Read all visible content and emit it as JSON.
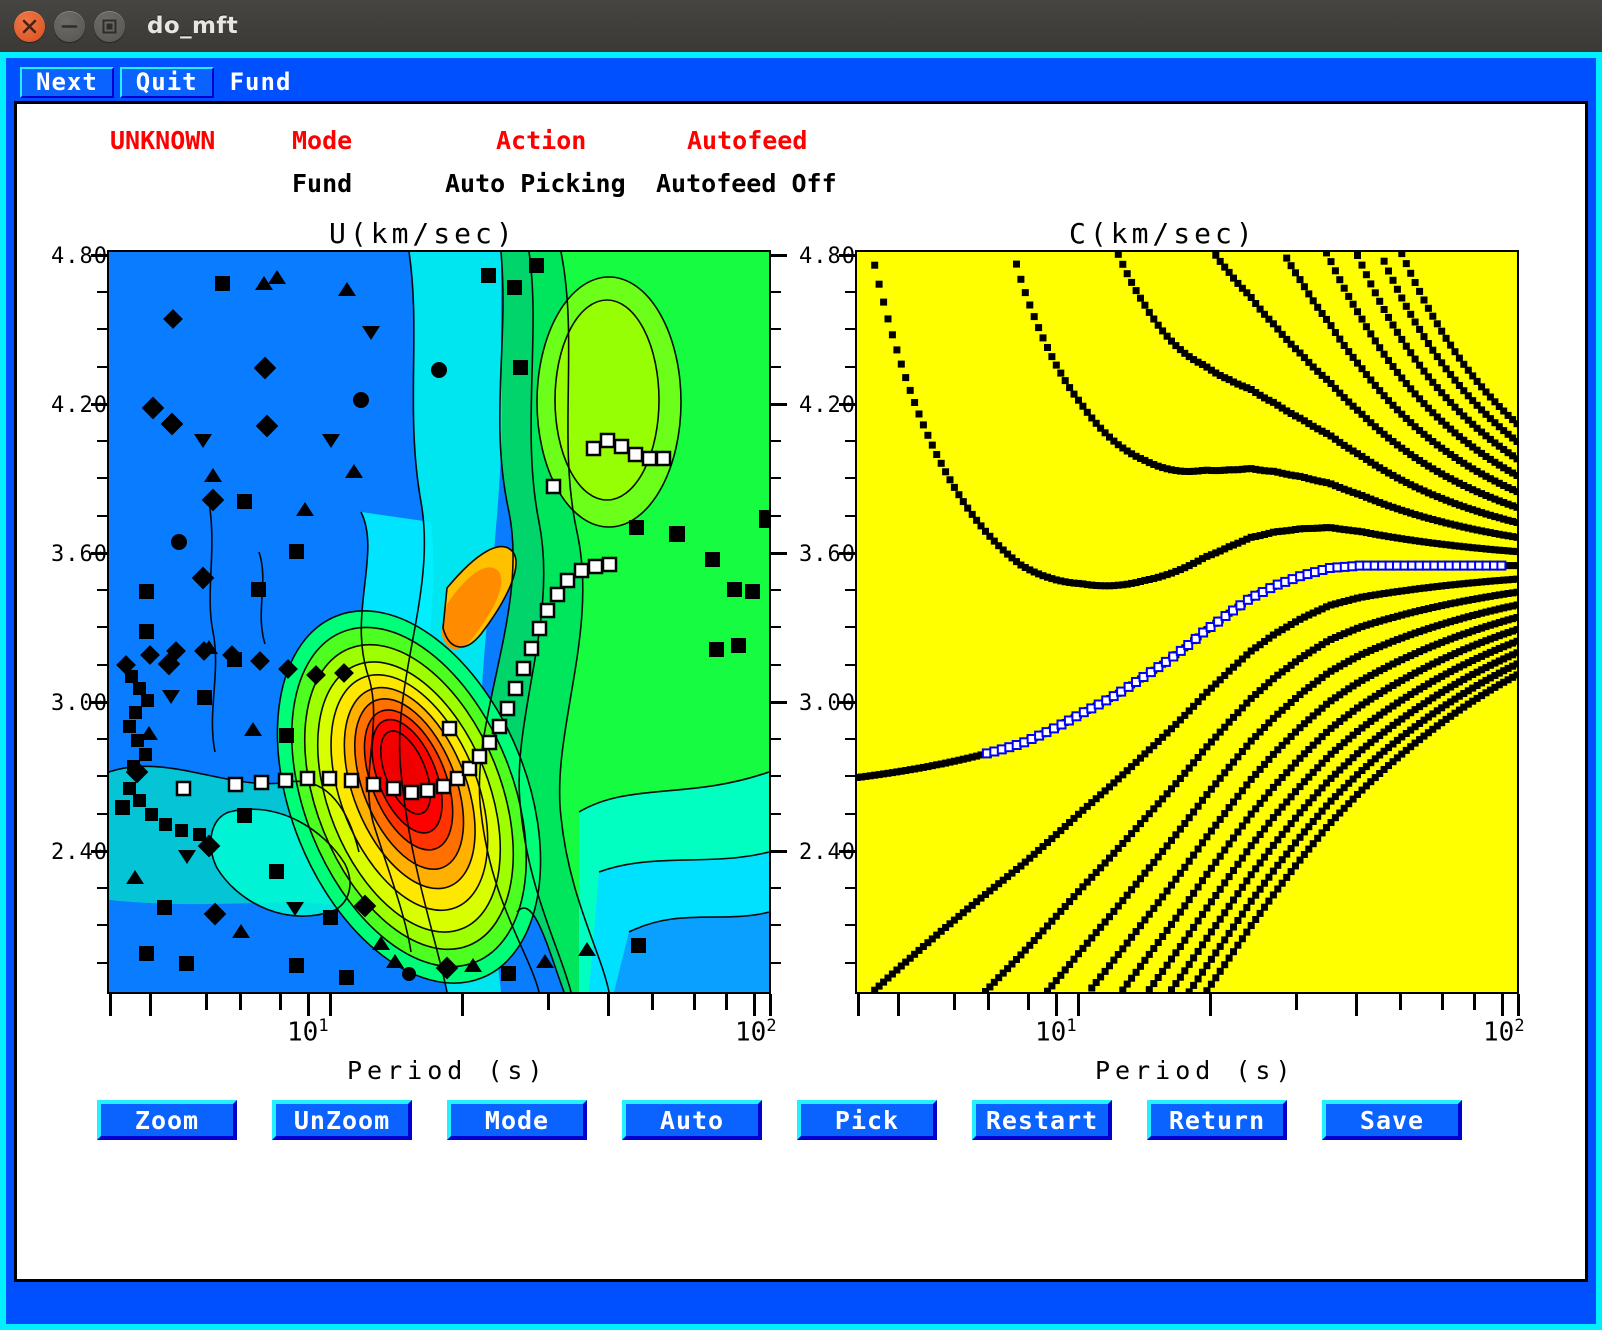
{
  "window": {
    "title": "do_mft",
    "buttons": {
      "close": "close-button",
      "minimize": "minimize-button",
      "maximize": "maximize-button"
    }
  },
  "menubar": {
    "items": [
      {
        "label": "Next",
        "raised": true
      },
      {
        "label": "Quit",
        "raised": true
      },
      {
        "label": "Fund",
        "raised": false
      }
    ]
  },
  "status": {
    "headers": [
      {
        "label": "UNKNOWN",
        "color": "#ff0000"
      },
      {
        "label": "Mode",
        "color": "#ff0000"
      },
      {
        "label": "Action",
        "color": "#ff0000"
      },
      {
        "label": "Autofeed",
        "color": "#ff0000"
      }
    ],
    "values": [
      {
        "label": "Fund",
        "color": "#000000"
      },
      {
        "label": "Auto Picking",
        "color": "#000000"
      },
      {
        "label": "Autofeed Off",
        "color": "#000000"
      }
    ]
  },
  "panels": {
    "left": {
      "title": "U(km/sec)",
      "xlabel": "Period (s)",
      "xticks": [
        "10¹",
        "10²"
      ],
      "yticks": [
        "4.80",
        "4.20",
        "3.60",
        "3.00",
        "2.40"
      ]
    },
    "right": {
      "title": "C(km/sec)",
      "xlabel": "Period (s)",
      "xticks": [
        "10¹",
        "10²"
      ],
      "yticks": [
        "4.80",
        "4.20",
        "3.60",
        "3.00",
        "2.40"
      ]
    }
  },
  "toolbar": {
    "buttons": [
      "Zoom",
      "UnZoom",
      "Mode",
      "Auto",
      "Pick",
      "Restart",
      "Return",
      "Save"
    ]
  },
  "colors": {
    "window_border_outer": "#00f0ff",
    "window_border_inner": "#0050ff",
    "button_face": "#0a62ff",
    "button_light": "#25f0ff",
    "button_dark": "#0000cf",
    "status_header": "#ff0000",
    "canvas": "#ffffff",
    "right_panel_bg": "#ffff00",
    "titlebar": "#3f3d3a"
  },
  "chart_data": [
    {
      "type": "heatmap",
      "title": "U(km/sec)",
      "xlabel": "Period (s)",
      "ylabel": "U (km/sec)",
      "xscale": "log",
      "xlim": [
        3.0,
        120.0
      ],
      "ylim": [
        2.1,
        5.05
      ],
      "xtick_labels": [
        "10¹",
        "10²"
      ],
      "ytick_labels": [
        "4.80",
        "4.20",
        "3.60",
        "3.00",
        "2.40"
      ],
      "ytick_values": [
        4.8,
        4.2,
        3.6,
        3.0,
        2.4
      ],
      "description": "Multiple Filter Technique group-velocity amplitude contour map with filled color contours (blue low -> red high) and overlaid black scatter markers for rejected picks, plus white-square picked dispersion points.",
      "contour_palette": [
        "#0a64ff",
        "#00a0ff",
        "#00d8ff",
        "#00ffd0",
        "#00ff90",
        "#00ff2a",
        "#80ff00",
        "#d8ff00",
        "#ffe000",
        "#ffa000",
        "#ff5000",
        "#ff0000"
      ],
      "picked_dispersion_points": [
        {
          "period": 5.2,
          "U": 2.84
        },
        {
          "period": 5.9,
          "U": 2.84
        },
        {
          "period": 6.5,
          "U": 2.85
        },
        {
          "period": 7.2,
          "U": 2.85
        },
        {
          "period": 7.9,
          "U": 2.86
        },
        {
          "period": 8.6,
          "U": 2.86
        },
        {
          "period": 9.4,
          "U": 2.85
        },
        {
          "period": 10.3,
          "U": 2.85
        },
        {
          "period": 11.2,
          "U": 2.84
        },
        {
          "period": 12.2,
          "U": 2.84
        },
        {
          "period": 13.3,
          "U": 2.83
        },
        {
          "period": 14.2,
          "U": 2.8
        },
        {
          "period": 15.1,
          "U": 2.79
        },
        {
          "period": 16.0,
          "U": 2.79
        },
        {
          "period": 17.0,
          "U": 2.8
        },
        {
          "period": 18.0,
          "U": 2.83
        },
        {
          "period": 19.0,
          "U": 2.87
        },
        {
          "period": 20.0,
          "U": 2.92
        },
        {
          "period": 21.0,
          "U": 2.97
        },
        {
          "period": 22.0,
          "U": 3.02
        },
        {
          "period": 23.0,
          "U": 3.08
        },
        {
          "period": 24.0,
          "U": 3.14
        },
        {
          "period": 25.0,
          "U": 3.22
        },
        {
          "period": 26.0,
          "U": 3.3
        },
        {
          "period": 27.5,
          "U": 3.38
        },
        {
          "period": 29.0,
          "U": 3.42
        },
        {
          "period": 30.5,
          "U": 3.44
        },
        {
          "period": 32.0,
          "U": 3.45
        },
        {
          "period": 35.0,
          "U": 3.6
        },
        {
          "period": 38.0,
          "U": 3.78
        },
        {
          "period": 41.0,
          "U": 3.8
        },
        {
          "period": 44.0,
          "U": 3.79
        },
        {
          "period": 48.0,
          "U": 3.77
        },
        {
          "period": 52.0,
          "U": 3.75
        }
      ],
      "peak": {
        "period": 20.0,
        "U": 2.9,
        "note": "main energy maximum (red core)"
      }
    },
    {
      "type": "scatter",
      "title": "C(km/sec)",
      "xlabel": "Period (s)",
      "ylabel": "C (km/sec)",
      "xscale": "log",
      "xlim": [
        3.0,
        120.0
      ],
      "ylim": [
        2.1,
        5.05
      ],
      "background": "#ffff00",
      "xtick_labels": [
        "10¹",
        "10²"
      ],
      "ytick_labels": [
        "4.80",
        "4.20",
        "3.60",
        "3.00",
        "2.40"
      ],
      "ytick_values": [
        4.8,
        4.2,
        3.6,
        3.0,
        2.4
      ],
      "description": "Phase-velocity 2-pi ambiguity lattice on yellow background; black dots are candidate phase velocities, the white/blue highlighted branch is the selected fundamental-mode phase velocity curve.",
      "selected_branch": [
        {
          "period": 6.5,
          "C": 3.06
        },
        {
          "period": 7.5,
          "C": 3.09
        },
        {
          "period": 8.5,
          "C": 3.13
        },
        {
          "period": 9.5,
          "C": 3.17
        },
        {
          "period": 10.5,
          "C": 3.21
        },
        {
          "period": 12.0,
          "C": 3.26
        },
        {
          "period": 13.5,
          "C": 3.31
        },
        {
          "period": 15.0,
          "C": 3.36
        },
        {
          "period": 17.0,
          "C": 3.42
        },
        {
          "period": 19.0,
          "C": 3.48
        },
        {
          "period": 21.0,
          "C": 3.54
        },
        {
          "period": 24.0,
          "C": 3.61
        },
        {
          "period": 27.0,
          "C": 3.67
        },
        {
          "period": 31.0,
          "C": 3.72
        },
        {
          "period": 36.0,
          "C": 3.76
        },
        {
          "period": 42.0,
          "C": 3.79
        },
        {
          "period": 50.0,
          "C": 3.8
        },
        {
          "period": 60.0,
          "C": 3.8
        }
      ]
    }
  ]
}
